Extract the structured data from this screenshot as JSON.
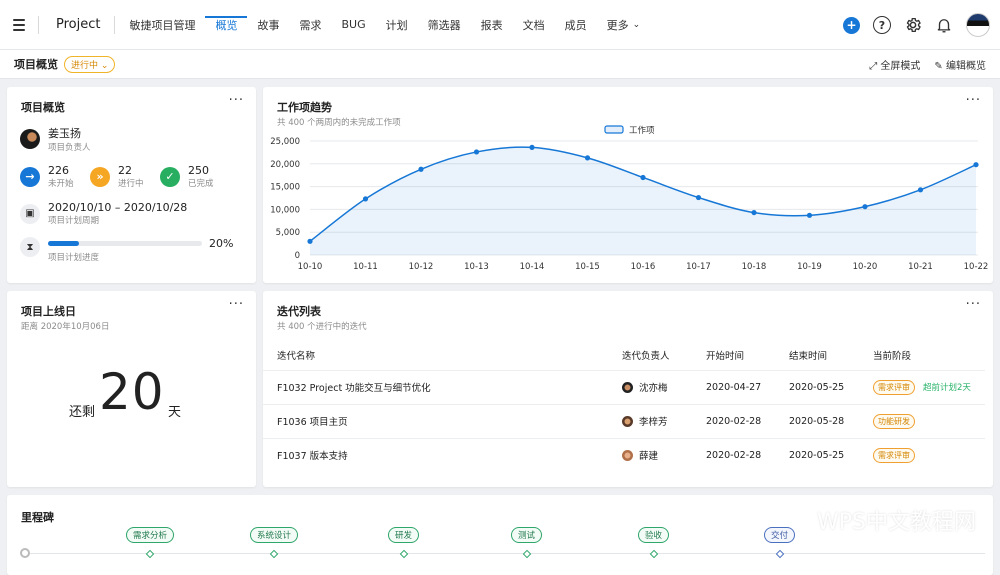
{
  "colors": {
    "accent": "#1677d6",
    "green": "#27ae60",
    "orange": "#f5a623",
    "window_red": "#ff5f57",
    "window_yellow": "#febc2e",
    "window_green": "#28c840"
  },
  "topbar": {
    "project_label": "Project",
    "tabs": [
      "敏捷项目管理",
      "概览",
      "故事",
      "需求",
      "BUG",
      "计划",
      "筛选器",
      "报表",
      "文档",
      "成员",
      "更多"
    ],
    "active_tab": "概览"
  },
  "subbar": {
    "title": "项目概览",
    "status": "进行中",
    "fullscreen": "全屏模式",
    "edit": "编辑概览"
  },
  "overview": {
    "title": "项目概览",
    "owner_name": "姜玉扬",
    "owner_role": "项目负责人",
    "stats": [
      {
        "value": "226",
        "label": "未开始"
      },
      {
        "value": "22",
        "label": "进行中"
      },
      {
        "value": "250",
        "label": "已完成"
      }
    ],
    "period": "2020/10/10 – 2020/10/28",
    "period_label": "项目计划周期",
    "progress_label": "项目计划进度",
    "progress_text": "20%",
    "progress_value": 0.2
  },
  "trend": {
    "title": "工作项趋势",
    "subtitle": "共 400 个两周内的未完成工作项",
    "legend": "工作项"
  },
  "chart_data": {
    "type": "area",
    "title": "工作项趋势",
    "categories": [
      "10-10",
      "10-11",
      "10-12",
      "10-13",
      "10-14",
      "10-15",
      "10-16",
      "10-17",
      "10-18",
      "10-19",
      "10-20",
      "10-21",
      "10-22"
    ],
    "series": [
      {
        "name": "工作项",
        "values": [
          3000,
          12300,
          18800,
          22600,
          23600,
          21300,
          17000,
          12600,
          9300,
          8700,
          10600,
          14300,
          19800
        ]
      }
    ],
    "y_ticks": [
      "0",
      "5,000",
      "10,000",
      "15,000",
      "20,000",
      "25,000"
    ],
    "ylim": [
      0,
      25000
    ],
    "grid": true,
    "legend_position": "top-center"
  },
  "launch": {
    "title": "项目上线日",
    "subtitle": "距离 2020年10月06日",
    "prefix": "还剩",
    "days": "20",
    "suffix": "天"
  },
  "iterations": {
    "title": "迭代列表",
    "subtitle": "共 400 个进行中的迭代",
    "headers": [
      "迭代名称",
      "迭代负责人",
      "开始时间",
      "结束时间",
      "当前阶段"
    ],
    "rows": [
      {
        "name": "F1032 Project 功能交互与细节优化",
        "owner": "沈亦梅",
        "start": "2020-04-27",
        "end": "2020-05-25",
        "stage": "需求评审",
        "note": "超前计划2天"
      },
      {
        "name": "F1036 项目主页",
        "owner": "李梓芳",
        "start": "2020-02-28",
        "end": "2020-05-28",
        "stage": "功能研发",
        "note": ""
      },
      {
        "name": "F1037 版本支持",
        "owner": "薛建",
        "start": "2020-02-28",
        "end": "2020-05-25",
        "stage": "需求评审",
        "note": ""
      }
    ]
  },
  "milestones": {
    "title": "里程碑",
    "items": [
      "需求分析",
      "系统设计",
      "研发",
      "测试",
      "验收",
      "交付"
    ]
  },
  "watermark": "WPS中文教程网"
}
